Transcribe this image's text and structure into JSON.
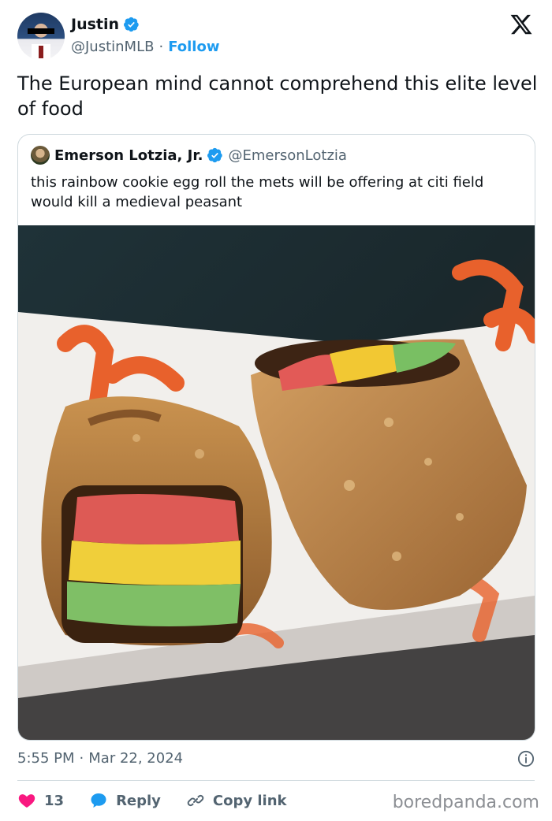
{
  "author": {
    "name": "Justin",
    "handle": "@JustinMLB",
    "separator": "·",
    "follow_label": "Follow"
  },
  "tweet": {
    "text": "The European mind cannot comprehend this elite level of food"
  },
  "quoted": {
    "name": "Emerson Lotzia, Jr.",
    "handle": "@EmersonLotzia",
    "text": "this rainbow cookie egg roll the mets will be offering at citi field would kill a medieval peasant"
  },
  "meta": {
    "time": "5:55 PM",
    "separator": "·",
    "date": "Mar 22, 2024"
  },
  "actions": {
    "likes": "13",
    "reply_label": "Reply",
    "copy_label": "Copy link"
  },
  "watermark": "boredpanda.com",
  "colors": {
    "accent": "#1d9bf0",
    "like": "#f91880",
    "text": "#0f1419",
    "muted": "#536471"
  }
}
